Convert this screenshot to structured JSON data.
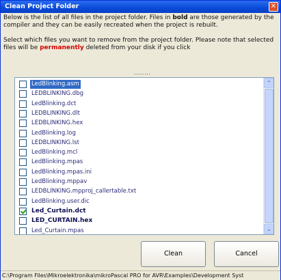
{
  "window": {
    "title": "Clean Project Folder",
    "close_glyph": "✕"
  },
  "description": {
    "line1_pre": "Below is the list of all files in the project folder. Files in ",
    "line1_bold": "bold",
    "line1_post": " are those generated by the compiler and they can be easily recreated when the project is rebuilt.",
    "line2_pre": "Select which files you want to remove from the project folder. Please note that selected files will be ",
    "line2_red": "permanently",
    "line2_post": " deleted from your disk if you click",
    "dots": "........"
  },
  "files": [
    {
      "name": "LedBlinking.asm",
      "checked": false,
      "bold": false,
      "selected": true
    },
    {
      "name": "LEDBLINKING.dbg",
      "checked": false,
      "bold": false,
      "selected": false
    },
    {
      "name": "LedBlinking.dct",
      "checked": false,
      "bold": false,
      "selected": false
    },
    {
      "name": "LEDBLINKING.dlt",
      "checked": false,
      "bold": false,
      "selected": false
    },
    {
      "name": "LEDBLINKING.hex",
      "checked": false,
      "bold": false,
      "selected": false
    },
    {
      "name": "LedBlinking.log",
      "checked": false,
      "bold": false,
      "selected": false
    },
    {
      "name": "LEDBLINKING.lst",
      "checked": false,
      "bold": false,
      "selected": false
    },
    {
      "name": "LedBlinking.mcl",
      "checked": false,
      "bold": false,
      "selected": false
    },
    {
      "name": "LedBlinking.mpas",
      "checked": false,
      "bold": false,
      "selected": false
    },
    {
      "name": "LedBlinking.mpas.ini",
      "checked": false,
      "bold": false,
      "selected": false
    },
    {
      "name": "LedBlinking.mppav",
      "checked": false,
      "bold": false,
      "selected": false
    },
    {
      "name": "LEDBLINKING.mpproj_callertable.txt",
      "checked": false,
      "bold": false,
      "selected": false
    },
    {
      "name": "LedBlinking.user.dic",
      "checked": false,
      "bold": false,
      "selected": false
    },
    {
      "name": "Led_Curtain.dct",
      "checked": true,
      "bold": true,
      "selected": false
    },
    {
      "name": "LED_CURTAIN.hex",
      "checked": false,
      "bold": true,
      "selected": false
    },
    {
      "name": "Led_Curtain.mpas",
      "checked": false,
      "bold": false,
      "selected": false
    }
  ],
  "buttons": {
    "clean": "Clean",
    "cancel": "Cancel"
  },
  "scrollbar": {
    "up_glyph": "⌃",
    "down_glyph": "⌄"
  },
  "status": {
    "path": "C:\\Program Files\\Mikroelektronika\\mikroPascal PRO for AVR\\Examples\\Development Syst"
  }
}
